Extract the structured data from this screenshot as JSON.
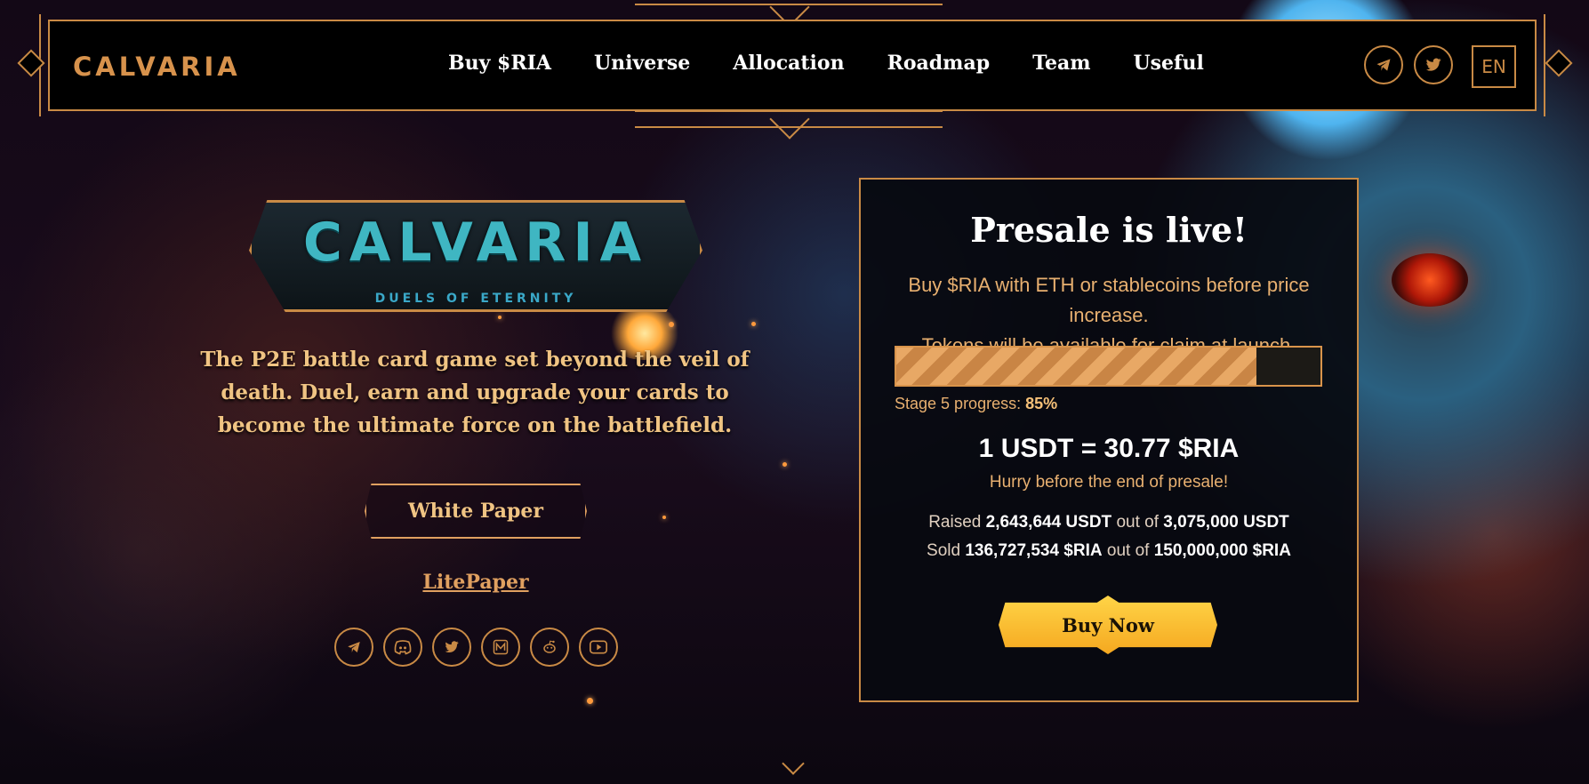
{
  "nav": {
    "logo": "CALVARIA",
    "items": [
      "Buy $RIA",
      "Universe",
      "Allocation",
      "Roadmap",
      "Team",
      "Useful"
    ],
    "social_icons": [
      "telegram-icon",
      "twitter-icon"
    ],
    "language": "EN"
  },
  "hero": {
    "game_logo_title": "CALVARIA",
    "game_logo_subtitle": "DUELS OF ETERNITY",
    "tagline": "The P2E battle card game set beyond the veil of death. Duel, earn and upgrade your cards to become the ultimate force on the battlefield.",
    "white_paper_label": "White Paper",
    "litepaper_label": "LitePaper",
    "social_icons": [
      "telegram-icon",
      "discord-icon",
      "twitter-icon",
      "medium-icon",
      "reddit-icon",
      "youtube-icon"
    ]
  },
  "presale": {
    "title": "Presale is live!",
    "description_line1": "Buy $RIA with ETH or stablecoins before price increase.",
    "description_line2": "Tokens will be available for claim at launch.",
    "progress_fraction": 0.85,
    "stage_label": "Stage 5 progress:",
    "stage_value": "85%",
    "price": "1 USDT = 30.77 $RIA",
    "hurry": "Hurry before the end of presale!",
    "raised_prefix": "Raised",
    "raised_amount": "2,643,644 USDT",
    "raised_mid": "out of",
    "raised_total": "3,075,000 USDT",
    "sold_prefix": "Sold",
    "sold_amount": "136,727,534 $RIA",
    "sold_mid": "out of",
    "sold_total": "150,000,000 $RIA",
    "buy_label": "Buy Now"
  },
  "colors": {
    "accent_gold": "#c98a45",
    "text_gold": "#e8b070",
    "buy_yellow": "#ffd447"
  }
}
